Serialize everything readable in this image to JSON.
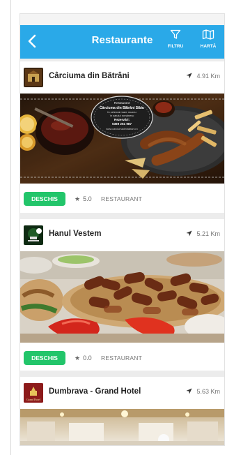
{
  "header": {
    "title": "Restaurante",
    "filter_label": "FILTRU",
    "map_label": "HARTĂ"
  },
  "restaurants": [
    {
      "name": "Cârciuma din Bătrâni",
      "distance": "4.91 Km",
      "status": "DESCHIS",
      "rating": "5.0",
      "category": "RESTAURANT",
      "photo_sign": {
        "line1": "Restaurant",
        "line2": "Cârciuma din Bătrâni Sibiu",
        "line3": "în celemai mare muzeu",
        "line4": "în satului românesc",
        "line5": "Rezervări:",
        "line6": "0369 251 987",
        "line7": "www.carciumadinbatrani.ro"
      }
    },
    {
      "name": "Hanul Vestem",
      "distance": "5.21 Km",
      "status": "DESCHIS",
      "rating": "0.0",
      "category": "RESTAURANT"
    },
    {
      "name": "Dumbrava - Grand Hotel",
      "distance": "5.63 Km",
      "logo_text": "Grand Hotel"
    }
  ],
  "colors": {
    "nav": "#2aa9e8",
    "open_badge": "#22c56a"
  },
  "icons": [
    "back-chevron-icon",
    "filter-funnel-icon",
    "map-icon",
    "navigation-arrow-icon",
    "star-icon"
  ]
}
